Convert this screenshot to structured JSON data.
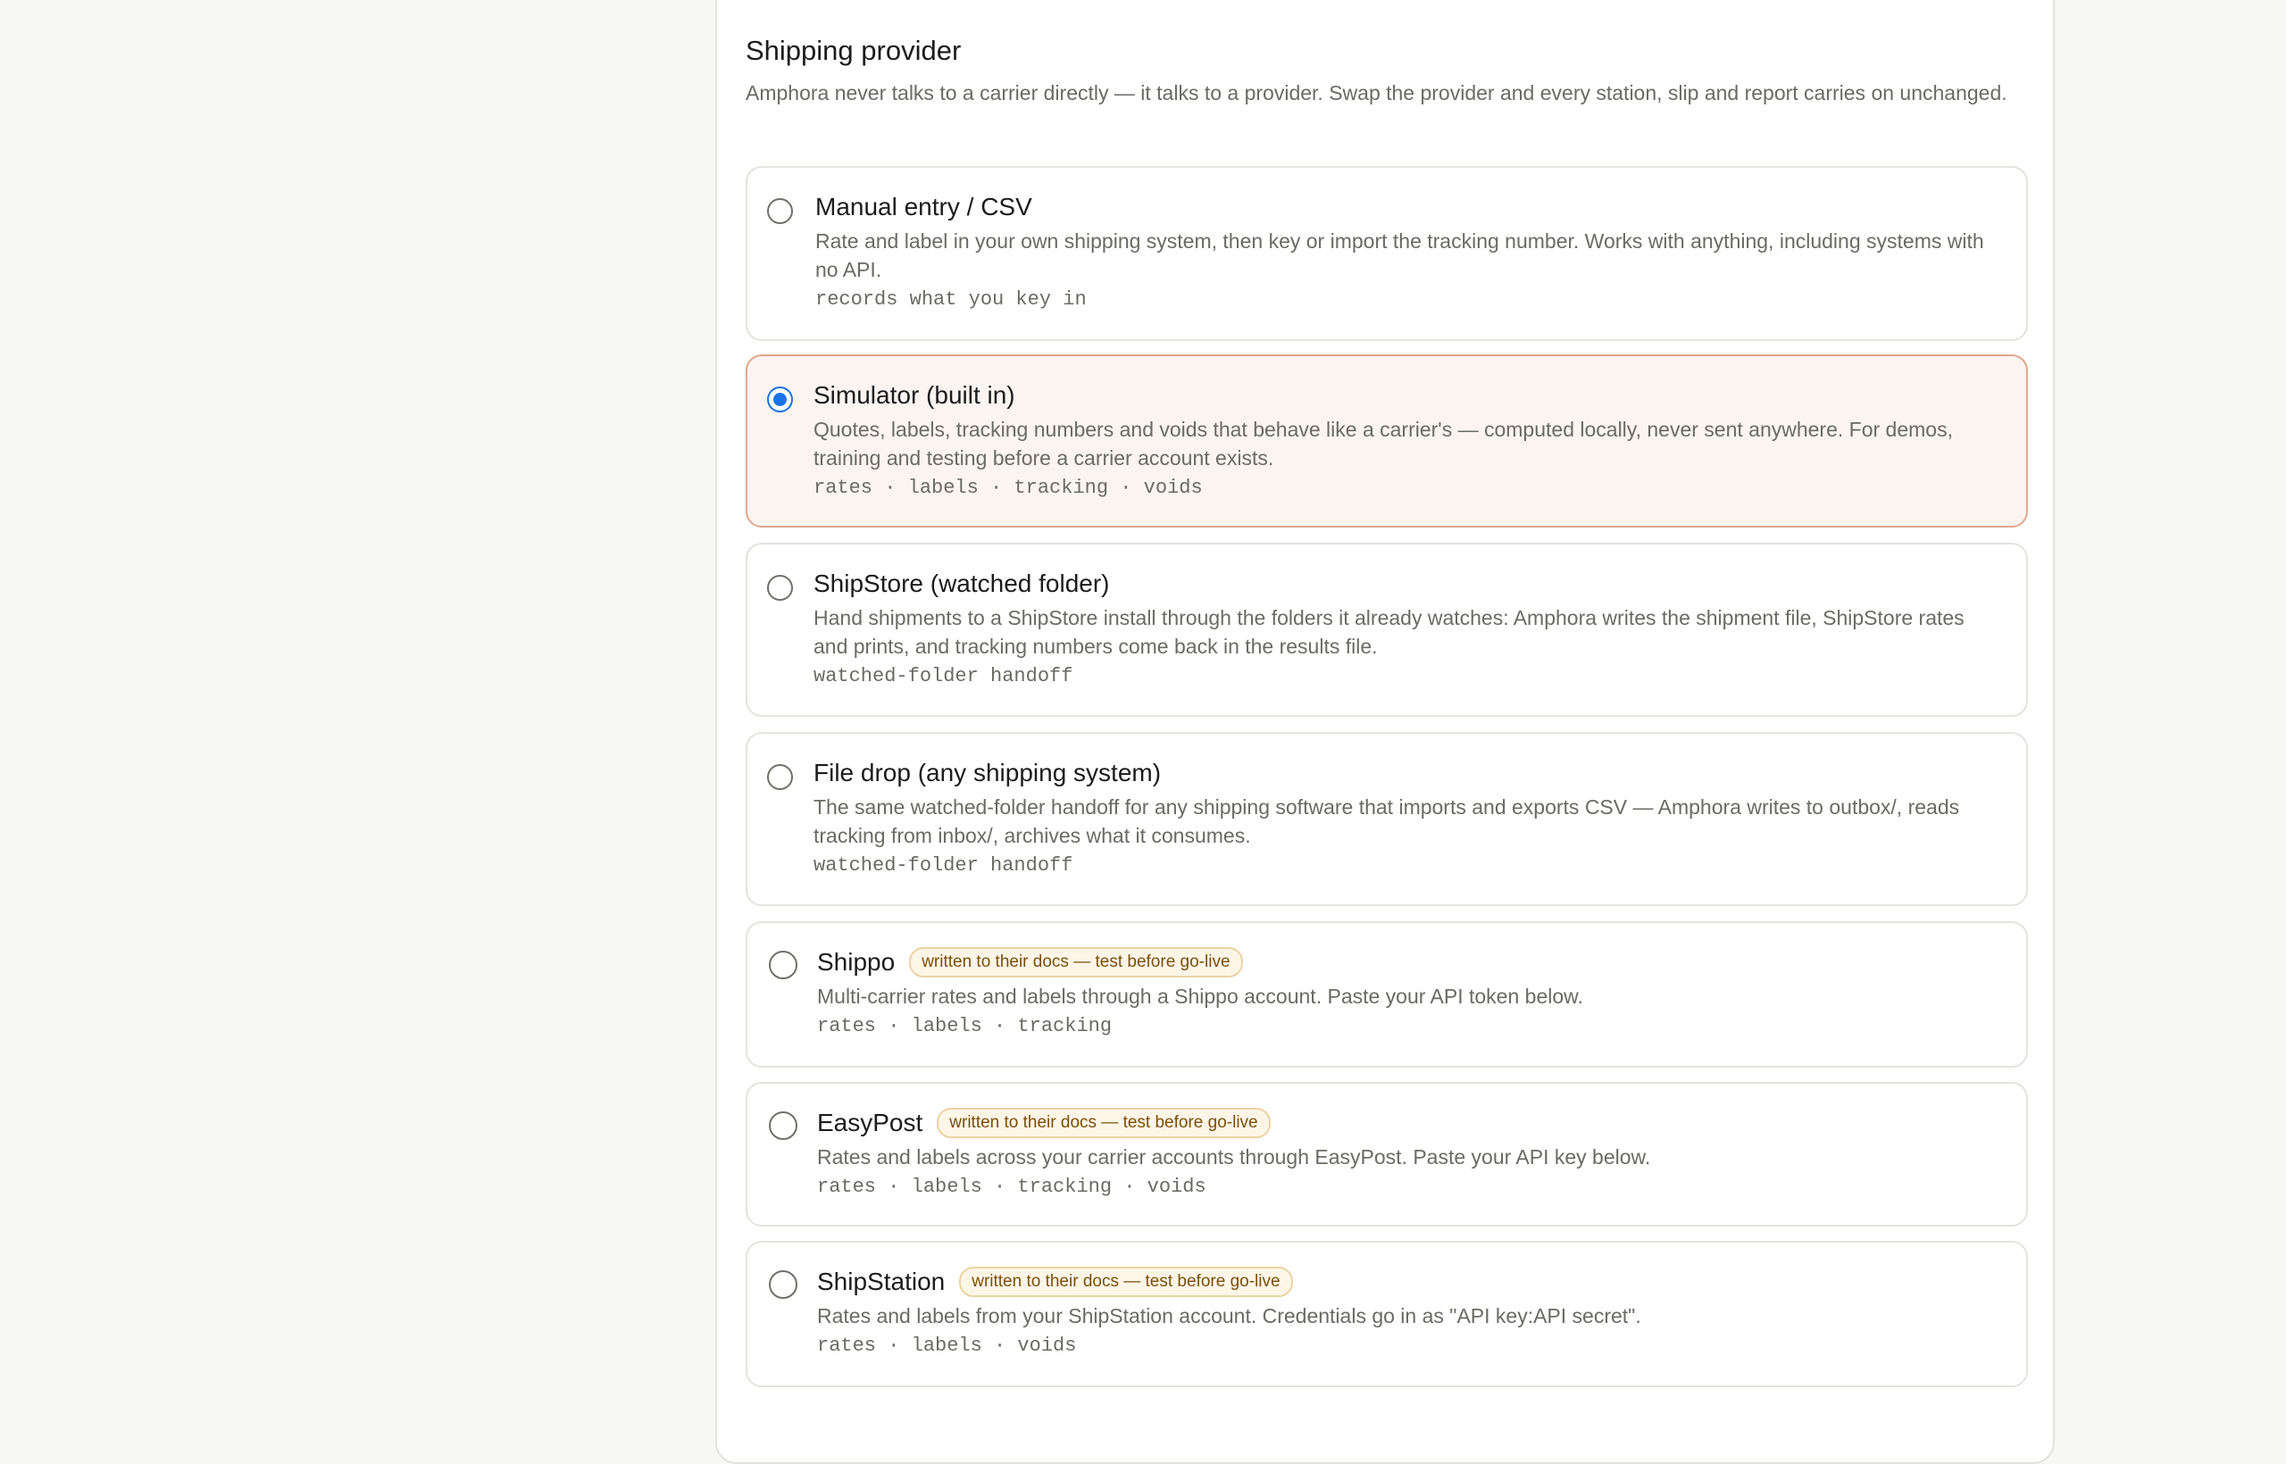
{
  "section": {
    "title": "Shipping provider",
    "description": "Amphora never talks to a carrier directly — it talks to a provider. Swap the provider and every station, slip and report carries on unchanged."
  },
  "options": [
    {
      "name": "Manual entry / CSV",
      "description": "Rate and label in your own shipping system, then key or import the tracking number. Works with anything, including systems with no API.",
      "capabilities": "records what you key in",
      "selected": false
    },
    {
      "name": "Simulator (built in)",
      "description": "Quotes, labels, tracking numbers and voids that behave like a carrier's — computed locally, never sent anywhere. For demos, training and testing before a carrier account exists.",
      "capabilities": "rates · labels · tracking · voids",
      "selected": true
    },
    {
      "name": "ShipStore (watched folder)",
      "description": "Hand shipments to a ShipStore install through the folders it already watches: Amphora writes the shipment file, ShipStore rates and prints, and tracking numbers come back in the results file.",
      "capabilities": "watched-folder handoff",
      "selected": false
    },
    {
      "name": "File drop (any shipping system)",
      "description": "The same watched-folder handoff for any shipping software that imports and exports CSV — Amphora writes to outbox/, reads tracking from inbox/, archives what it consumes.",
      "capabilities": "watched-folder handoff",
      "selected": false
    },
    {
      "name": "Shippo",
      "badge": "written to their docs — test before go-live",
      "description": "Multi-carrier rates and labels through a Shippo account. Paste your API token below.",
      "capabilities": "rates · labels · tracking",
      "selected": false
    },
    {
      "name": "EasyPost",
      "badge": "written to their docs — test before go-live",
      "description": "Rates and labels across your carrier accounts through EasyPost. Paste your API key below.",
      "capabilities": "rates · labels · tracking · voids",
      "selected": false
    },
    {
      "name": "ShipStation",
      "badge": "written to their docs — test before go-live",
      "description": "Rates and labels from your ShipStation account. Credentials go in as \"API key:API secret\".",
      "capabilities": "rates · labels · voids",
      "selected": false
    }
  ],
  "colors": {
    "accent": "#1a73e8",
    "selected_border": "#e2a78f",
    "selected_background": "#fbf4f0",
    "badge_background": "#fdf6e7",
    "badge_text": "#7a4f0d"
  }
}
